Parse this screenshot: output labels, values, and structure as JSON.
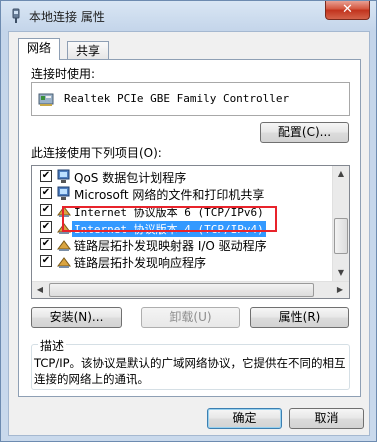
{
  "window": {
    "title": "本地连接 属性",
    "close_glyph": "✕"
  },
  "tabs": [
    {
      "label": "网络"
    },
    {
      "label": "共享"
    }
  ],
  "connect_using_label": "连接时使用:",
  "adapter_name": "Realtek PCIe GBE Family Controller",
  "configure_button": "配置(C)...",
  "items_label": "此连接使用下列项目(O):",
  "items": [
    {
      "label": "QoS 数据包计划程序",
      "checked": true,
      "icon": "network-client-icon"
    },
    {
      "label": "Microsoft 网络的文件和打印机共享",
      "checked": true,
      "icon": "network-client-icon"
    },
    {
      "label": "Internet 协议版本 6 (TCP/IPv6)",
      "checked": true,
      "icon": "protocol-icon"
    },
    {
      "label": "Internet 协议版本 4 (TCP/IPv4)",
      "checked": true,
      "icon": "protocol-icon",
      "selected": true
    },
    {
      "label": "链路层拓扑发现映射器 I/O 驱动程序",
      "checked": true,
      "icon": "protocol-icon"
    },
    {
      "label": "链路层拓扑发现响应程序",
      "checked": true,
      "icon": "protocol-icon"
    }
  ],
  "buttons": {
    "install": "安装(N)...",
    "uninstall": "卸载(U)",
    "properties": "属性(R)",
    "ok": "确定",
    "cancel": "取消"
  },
  "description": {
    "legend": "描述",
    "text": "TCP/IP。该协议是默认的广域网络协议，它提供在不同的相互连接的网络上的通讯。"
  },
  "colors": {
    "selection": "#3399ff",
    "highlight_box": "#e8232b",
    "close_button": "#c1321c"
  }
}
